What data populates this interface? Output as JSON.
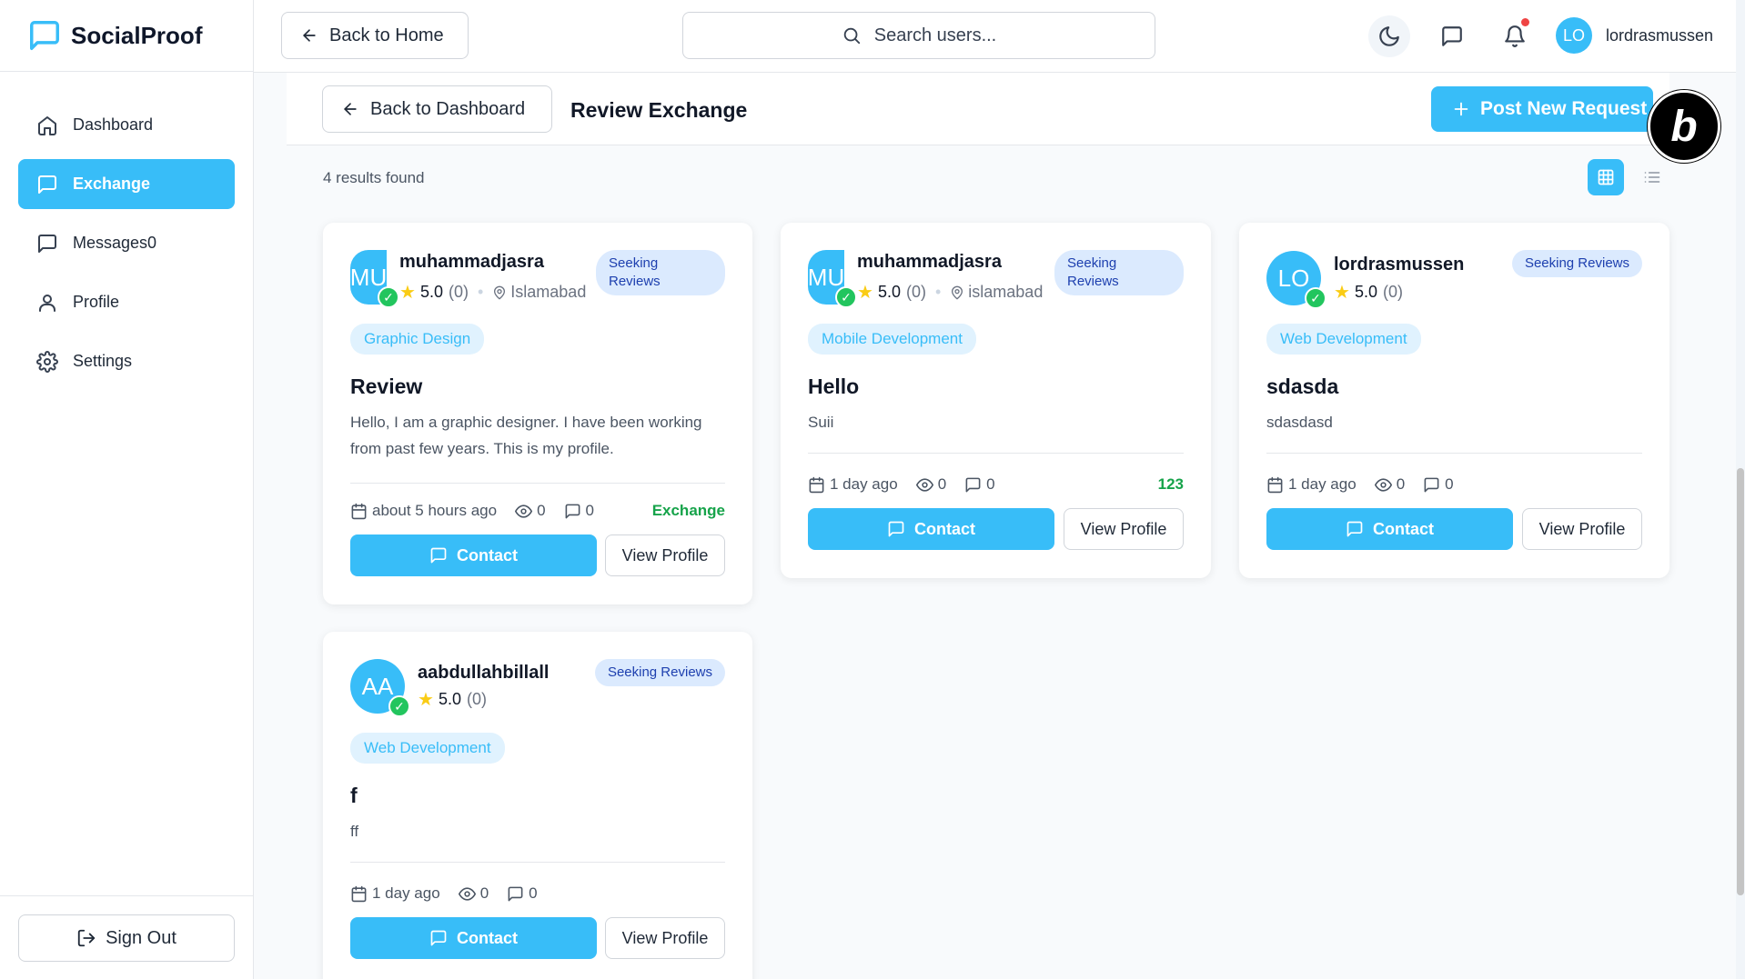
{
  "app": {
    "name": "SocialProof"
  },
  "sidebar": {
    "items": [
      {
        "label": "Dashboard",
        "icon": "home-icon"
      },
      {
        "label": "Exchange",
        "icon": "message-square-icon",
        "active": true
      },
      {
        "label": "Messages0",
        "icon": "message-square-icon"
      },
      {
        "label": "Profile",
        "icon": "user-icon"
      },
      {
        "label": "Settings",
        "icon": "gear-icon"
      }
    ],
    "sign_out": "Sign Out"
  },
  "topbar": {
    "back_home": "Back to Home",
    "search_placeholder": "Search users...",
    "avatar_initials": "LO",
    "username": "lordrasmussen"
  },
  "subheader": {
    "back_dashboard": "Back to Dashboard",
    "title": "Review Exchange",
    "post_button": "Post New Request"
  },
  "results_text": "4 results found",
  "cards": [
    {
      "initials": "MU",
      "name": "muhammadjasra",
      "rating": "5.0",
      "reviews": "(0)",
      "location": "Islamabad",
      "status": "Seeking Reviews",
      "category": "Graphic Design",
      "title": "Review",
      "description": "Hello, I am a graphic designer. I have been working from past few years. This is my profile.",
      "time": "about 5 hours ago",
      "views": "0",
      "comments": "0",
      "tag": "Exchange",
      "contact": "Contact",
      "view_profile": "View Profile"
    },
    {
      "initials": "MU",
      "name": "muhammadjasra",
      "rating": "5.0",
      "reviews": "(0)",
      "location": "islamabad",
      "status": "Seeking Reviews",
      "category": "Mobile Development",
      "title": "Hello",
      "description": "Suii",
      "time": "1 day ago",
      "views": "0",
      "comments": "0",
      "tag": "123",
      "contact": "Contact",
      "view_profile": "View Profile"
    },
    {
      "initials": "LO",
      "name": "lordrasmussen",
      "rating": "5.0",
      "reviews": "(0)",
      "status": "Seeking Reviews",
      "category": "Web Development",
      "title": "sdasda",
      "description": "sdasdasd",
      "time": "1 day ago",
      "views": "0",
      "comments": "0",
      "contact": "Contact",
      "view_profile": "View Profile"
    },
    {
      "initials": "AA",
      "name": "aabdullahbillall",
      "rating": "5.0",
      "reviews": "(0)",
      "status": "Seeking Reviews",
      "category": "Web Development",
      "title": "f",
      "description": "ff",
      "time": "1 day ago",
      "views": "0",
      "comments": "0",
      "contact": "Contact",
      "view_profile": "View Profile"
    }
  ],
  "colors": {
    "accent": "#38bdf8",
    "verified": "#22c55e",
    "tag_green": "#16a34a",
    "notification": "#ef4444"
  }
}
